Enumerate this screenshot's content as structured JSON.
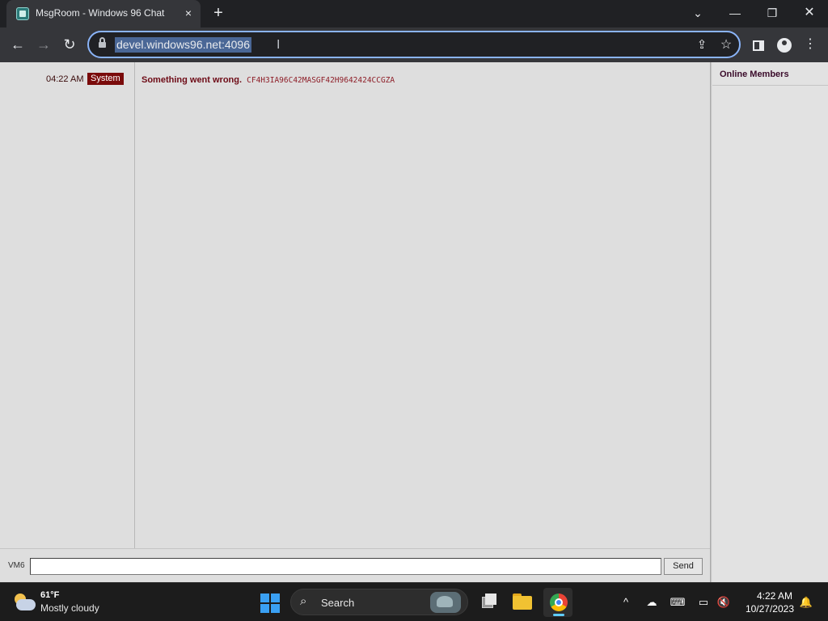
{
  "browser": {
    "tab_title": "MsgRoom - Windows 96 Chat",
    "tab_close": "×",
    "new_tab": "+",
    "url": "devel.windows96.net:4096",
    "text_cursor": "I",
    "share_glyph": "⇪",
    "star_glyph": "☆",
    "menu_glyph": "⋮",
    "nav": {
      "back": "←",
      "forward": "→",
      "reload": "↻"
    },
    "window": {
      "tab_search": "⌄",
      "minimize": "—",
      "restore": "❐",
      "close": "✕"
    }
  },
  "chat": {
    "messages": [
      {
        "time": "04:22 AM",
        "user": "System",
        "text": "Something went wrong.",
        "code": "CF4H3IA96C42MASGF42H9642424CCGZA"
      }
    ],
    "members_title": "Online Members",
    "input_label": "VM6",
    "input_value": "",
    "send_label": "Send"
  },
  "taskbar": {
    "weather_temp": "61°F",
    "weather_desc": "Mostly cloudy",
    "search_label": "Search",
    "search_glyph": "⌕",
    "tray": {
      "chevron": "^",
      "onedrive": "☁",
      "keyboard": "⌨",
      "network": "▭",
      "volume": "🔇",
      "bell": "🔔"
    },
    "time": "4:22 AM",
    "date": "10/27/2023"
  },
  "colors": {
    "browser_frame": "#202124",
    "toolbar": "#35363a",
    "page_bg": "#dedede",
    "system_badge": "#7a0b0b",
    "error_text": "#6e0b16",
    "taskbar": "#1c1c1c"
  }
}
